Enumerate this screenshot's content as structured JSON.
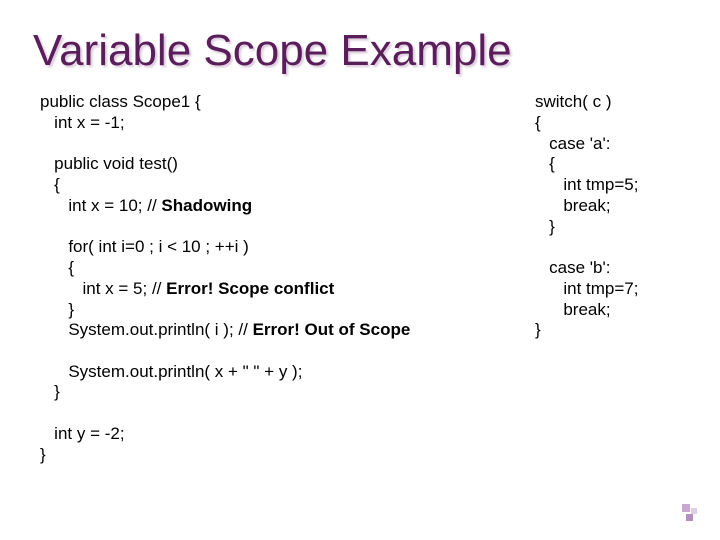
{
  "title": "Variable Scope Example",
  "left": {
    "l1": "public class Scope1 {",
    "l2": "   int x = -1;",
    "l3": "",
    "l4": "   public void test()",
    "l5": "   {",
    "l6a": "      int x = 10; // ",
    "l6b": "Shadowing",
    "l7": "",
    "l8": "      for( int i=0 ; i < 10 ; ++i )",
    "l9": "      {",
    "l10a": "         int x = 5; // ",
    "l10b": "Error! Scope conflict",
    "l11": "      }",
    "l12a": "      System.out.println( i ); // ",
    "l12b": "Error! Out of Scope",
    "l13": "",
    "l14": "      System.out.println( x + \" \" + y );",
    "l15": "   }",
    "l16": "",
    "l17": "   int y = -2;",
    "l18": "}"
  },
  "right": {
    "r1": "switch( c )",
    "r2": "{",
    "r3": "   case 'a':",
    "r4": "   {",
    "r5": "      int tmp=5;",
    "r6": "      break;",
    "r7": "   }",
    "r8": "",
    "r9": "   case 'b':",
    "r10": "      int tmp=7;",
    "r11": "      break;",
    "r12": "}"
  }
}
